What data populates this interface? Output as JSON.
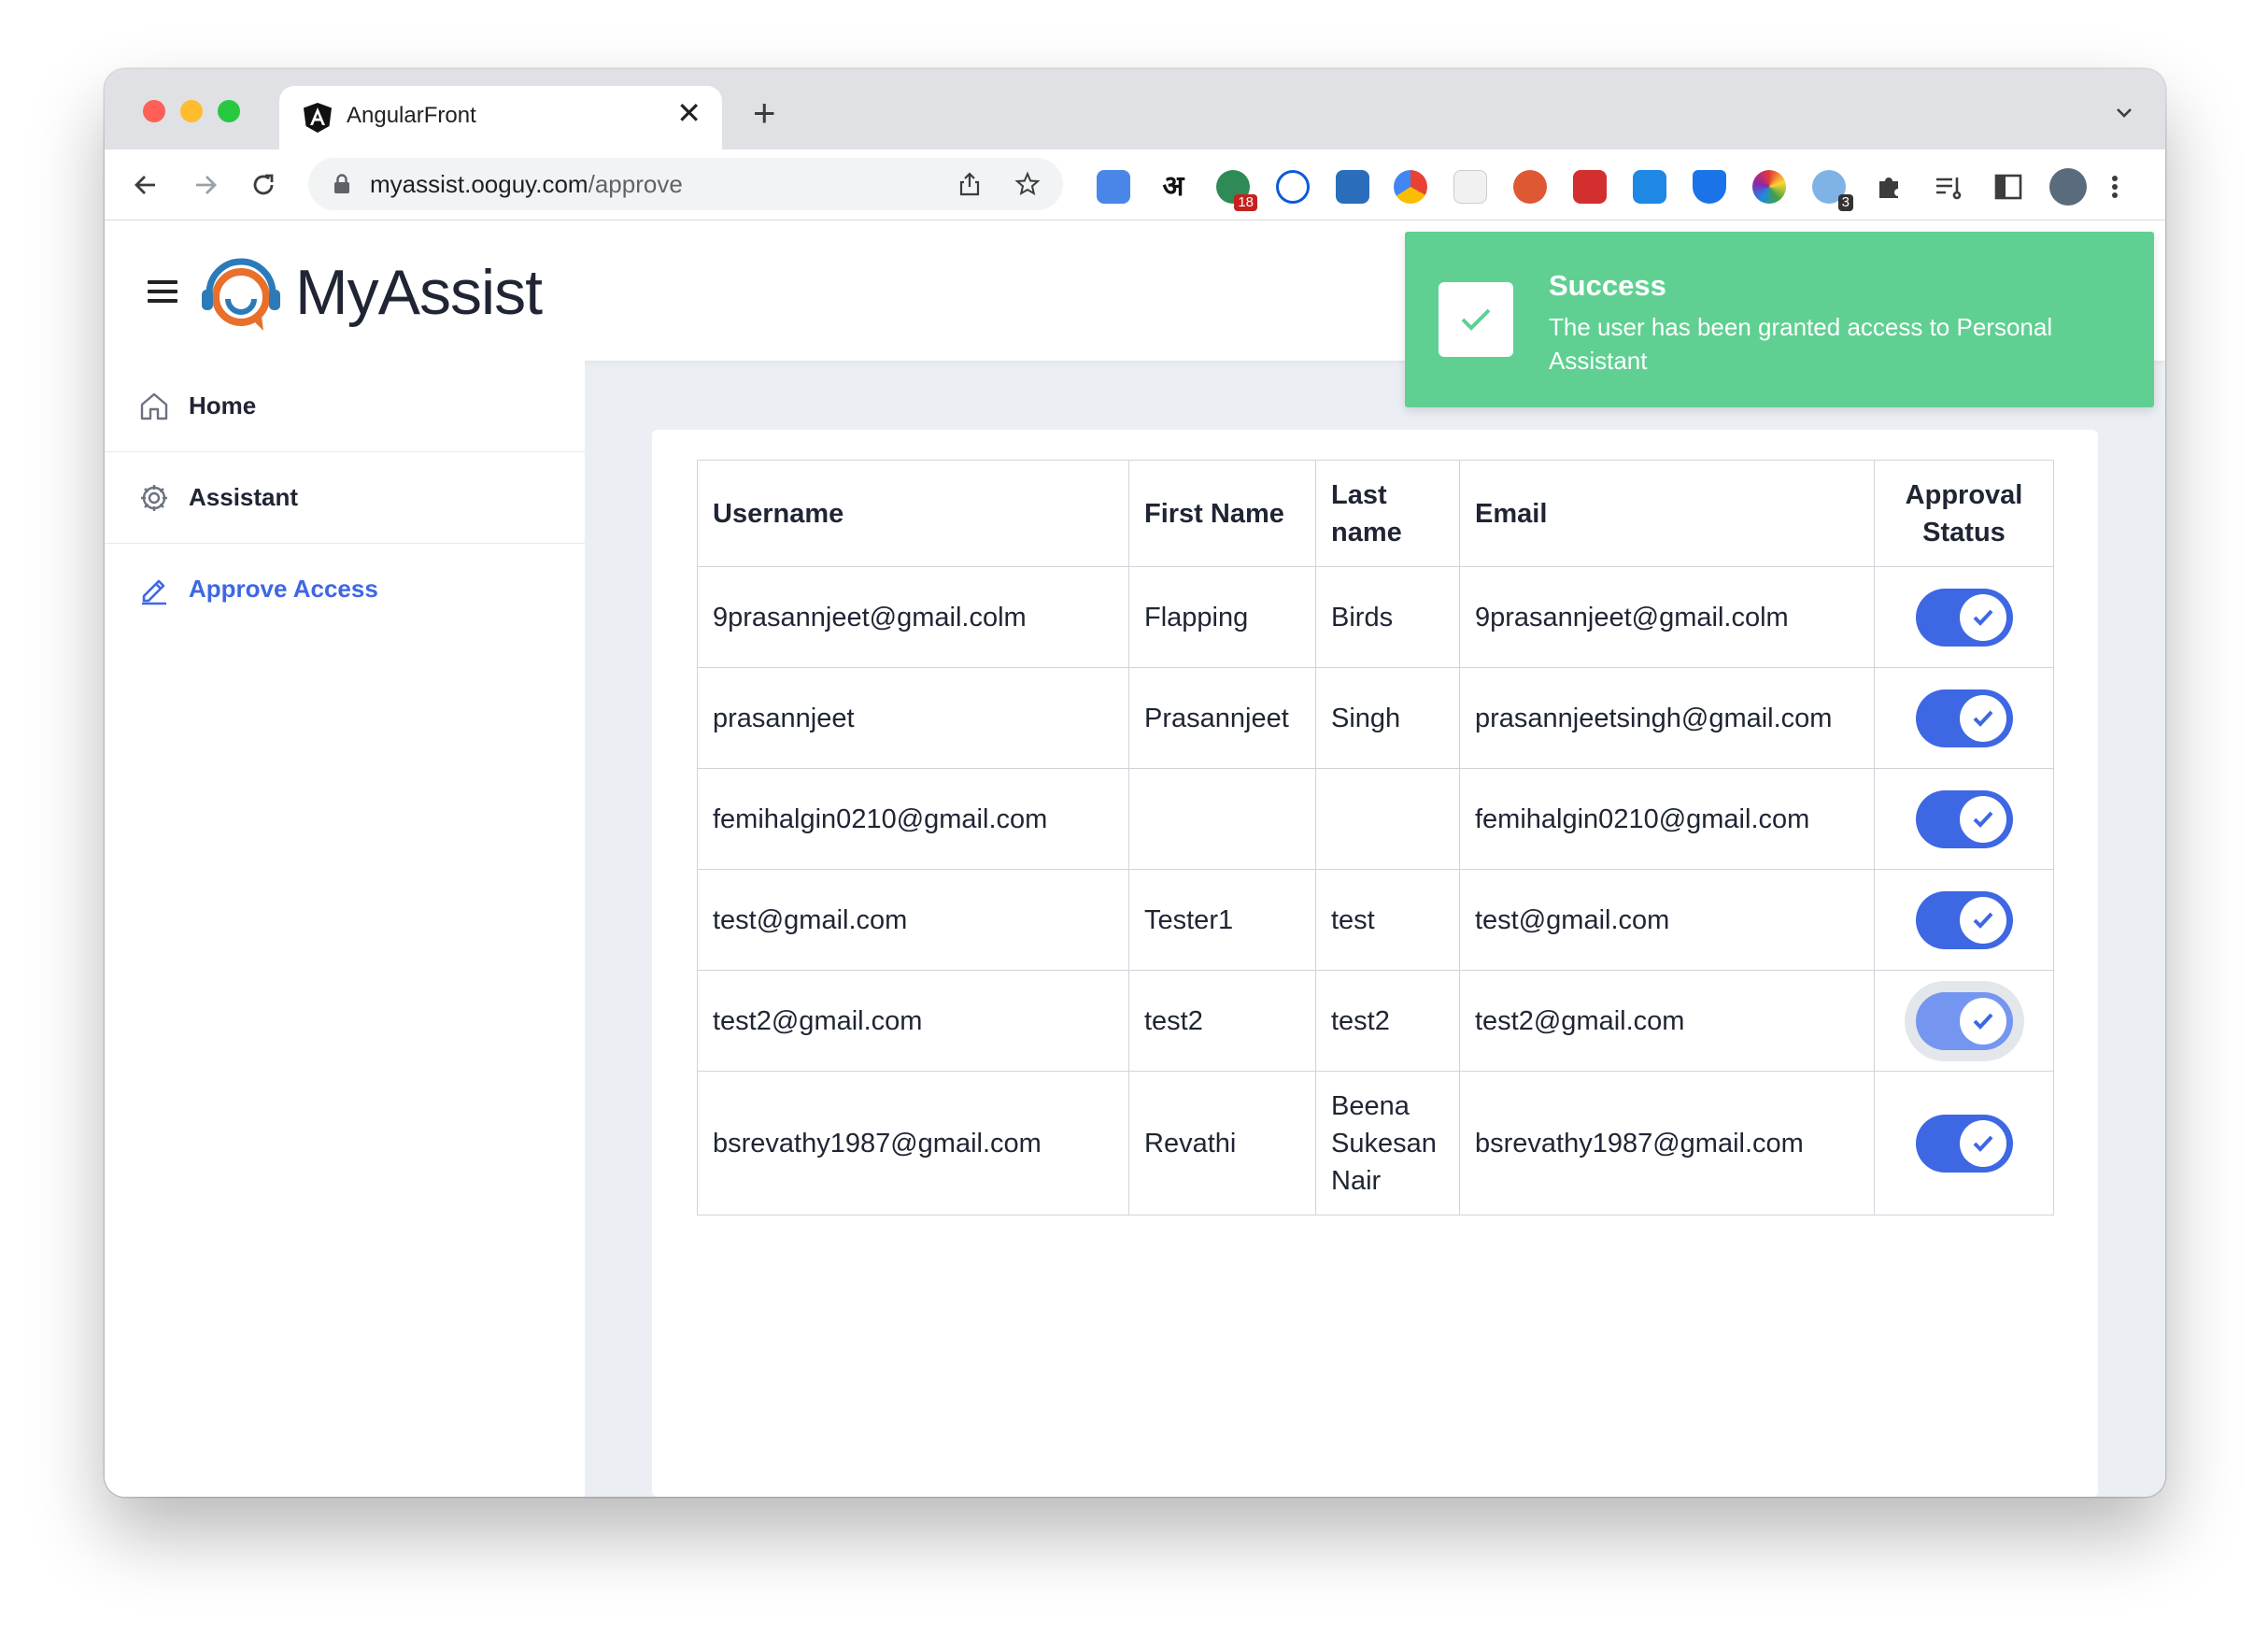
{
  "browser": {
    "tab_title": "AngularFront",
    "new_tab_label": "+",
    "close_label": "✕",
    "url_host": "myassist.ooguy.com",
    "url_path": "/approve",
    "extension_badges": {
      "ext3": "18",
      "ext15": "3"
    }
  },
  "app": {
    "brand": "MyAssist",
    "colors": {
      "accent": "#3e67e4",
      "toast": "#5fd092",
      "text": "#1f2533"
    }
  },
  "sidebar": {
    "items": [
      {
        "label": "Home",
        "icon": "home-icon",
        "active": false
      },
      {
        "label": "Assistant",
        "icon": "gear-icon",
        "active": false
      },
      {
        "label": "Approve Access",
        "icon": "pencil-icon",
        "active": true
      }
    ]
  },
  "table": {
    "headers": [
      "Username",
      "First Name",
      "Last name",
      "Email",
      "Approval Status"
    ],
    "rows": [
      {
        "username": "9prasannjeet@gmail.colm",
        "first": "Flapping",
        "last": "Birds",
        "email": "9prasannjeet@gmail.colm",
        "approved": true
      },
      {
        "username": "prasannjeet",
        "first": "Prasannjeet",
        "last": "Singh",
        "email": "prasannjeetsingh@gmail.com",
        "approved": true
      },
      {
        "username": "femihalgin0210@gmail.com",
        "first": "",
        "last": "",
        "email": "femihalgin0210@gmail.com",
        "approved": true
      },
      {
        "username": "test@gmail.com",
        "first": "Tester1",
        "last": "test",
        "email": "test@gmail.com",
        "approved": true
      },
      {
        "username": "test2@gmail.com",
        "first": "test2",
        "last": "test2",
        "email": "test2@gmail.com",
        "approved": true
      },
      {
        "username": "bsrevathy1987@gmail.com",
        "first": "Revathi",
        "last": "Beena Sukesan Nair",
        "email": "bsrevathy1987@gmail.com",
        "approved": true
      }
    ]
  },
  "toast": {
    "title": "Success",
    "message": "The user has been granted access to Personal Assistant",
    "icon": "check-icon"
  }
}
